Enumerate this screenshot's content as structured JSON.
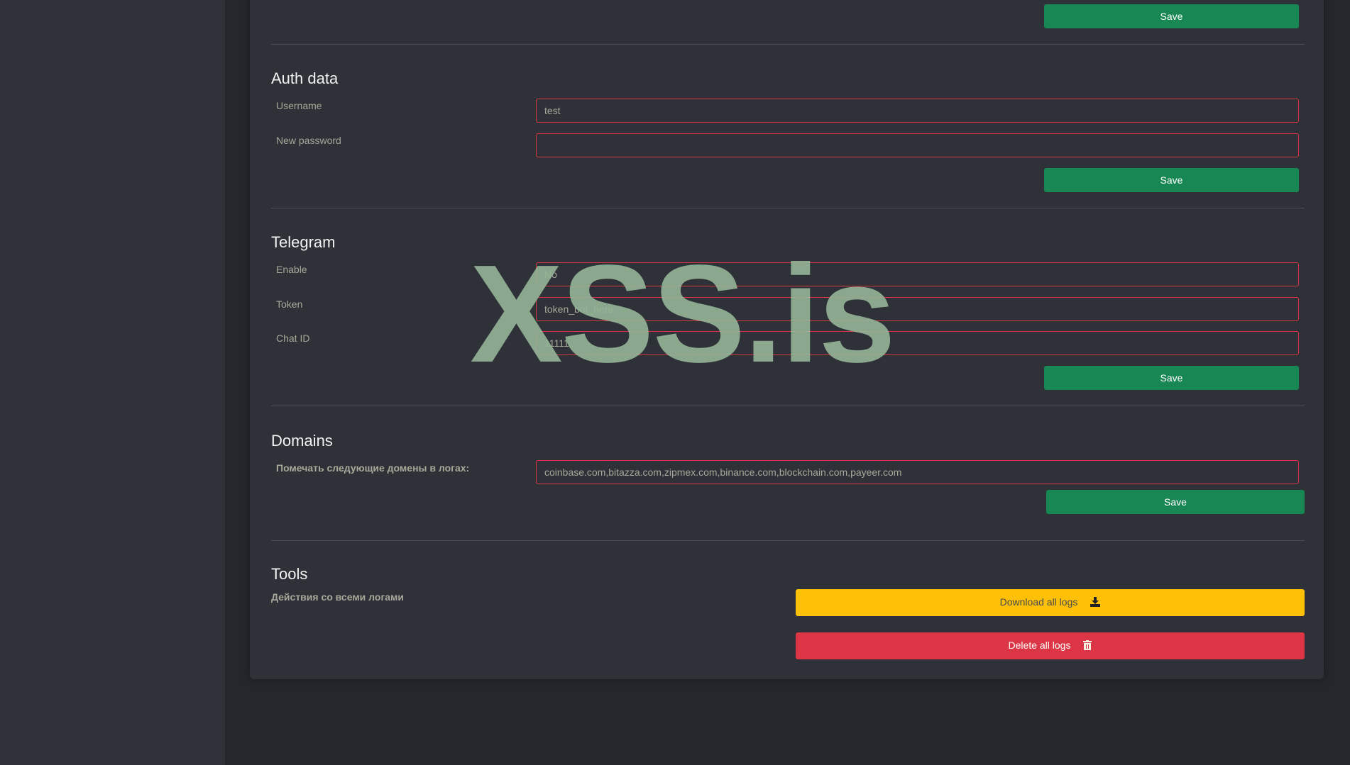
{
  "top_save": "Save",
  "auth": {
    "title": "Auth data",
    "username_label": "Username",
    "username_value": "test",
    "password_label": "New password",
    "password_value": "",
    "save": "Save"
  },
  "telegram": {
    "title": "Telegram",
    "enable_label": "Enable",
    "enable_value": "No",
    "token_label": "Token",
    "token_value": "token_bot_here",
    "chat_label": "Chat ID",
    "chat_value": "11111",
    "save": "Save"
  },
  "domains": {
    "title": "Domains",
    "label": "Помечать следующие домены в логах:",
    "value": "coinbase.com,bitazza.com,zipmex.com,binance.com,blockchain.com,payeer.com",
    "save": "Save"
  },
  "tools": {
    "title": "Tools",
    "label": "Действия со всеми логами",
    "download": "Download all logs",
    "delete": "Delete all logs"
  },
  "watermark": "XSS.is",
  "colors": {
    "save": "#198754",
    "download": "#ffc107",
    "delete": "#dc3545"
  }
}
